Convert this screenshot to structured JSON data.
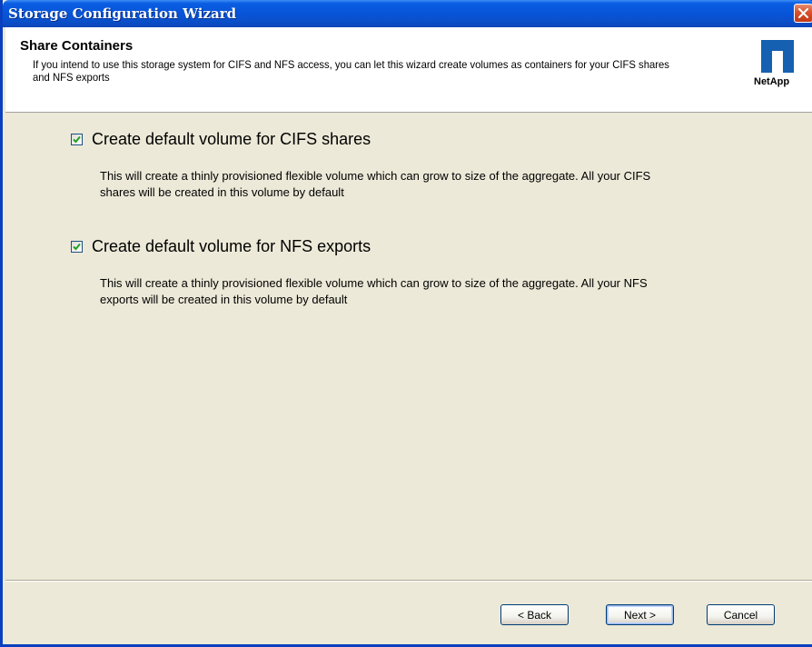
{
  "window": {
    "title": "Storage Configuration Wizard"
  },
  "header": {
    "title": "Share Containers",
    "description": "If you intend to use this storage system for CIFS and NFS access, you can let this wizard create volumes as containers for your CIFS shares and NFS exports",
    "logo_text": "NetApp"
  },
  "options": [
    {
      "label": "Create default volume for CIFS shares",
      "checked": true,
      "description": "This will create a thinly provisioned flexible volume which can grow to size of the aggregate. All your CIFS shares will be created in this volume by default"
    },
    {
      "label": "Create default volume for NFS exports",
      "checked": true,
      "description": "This will create a thinly provisioned flexible volume which can grow to size of the aggregate. All your NFS exports will be created in this volume by default"
    }
  ],
  "buttons": {
    "back": "< Back",
    "next": "Next >",
    "cancel": "Cancel"
  },
  "colors": {
    "titlebar": "#0854d8",
    "window_bg": "#ece9d8",
    "close_button": "#d8512c",
    "logo": "#1560b0",
    "checkmark": "#21a121"
  },
  "icons": {
    "close": "close-icon",
    "checkbox": "checkmark-icon",
    "logo": "netapp-logo-icon"
  }
}
